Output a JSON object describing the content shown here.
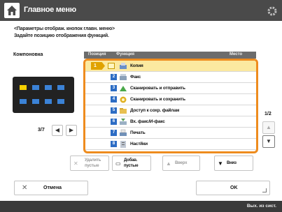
{
  "window": {
    "title": "Главное меню"
  },
  "instructions": {
    "line1": "<Параметры отображ. кнопок главн. меню>",
    "line2": "Задайте позицию отображения функций."
  },
  "layout": {
    "label": "Компоновка",
    "page_indicator": "3/7"
  },
  "list_header": {
    "col1": "Позиция",
    "col2": "Функция",
    "col3": "Место"
  },
  "list": {
    "page_indicator": "1/2",
    "rows": [
      {
        "num": "1",
        "label": "Копия",
        "selected": true,
        "icon": "copy-icon"
      },
      {
        "num": "2",
        "label": "Факс",
        "selected": false,
        "icon": "fax-icon"
      },
      {
        "num": "3",
        "label": "Сканировать и отправить",
        "selected": false,
        "icon": "scan-send-icon"
      },
      {
        "num": "4",
        "label": "Сканировать и сохранить",
        "selected": false,
        "icon": "scan-store-icon"
      },
      {
        "num": "5",
        "label": "Доступ к сохр. файлам",
        "selected": false,
        "icon": "stored-files-icon"
      },
      {
        "num": "6",
        "label": "Вх. факс/И-факс",
        "selected": false,
        "icon": "inbox-fax-icon"
      },
      {
        "num": "7",
        "label": "Печать",
        "selected": false,
        "icon": "print-icon"
      },
      {
        "num": "8",
        "label": "Настйки",
        "selected": false,
        "icon": "settings-icon"
      }
    ]
  },
  "actions": {
    "delete_blank": {
      "line1": "Удалить",
      "line2": "пустые"
    },
    "add_blank": {
      "line1": "Добав.",
      "line2": "пустые"
    },
    "up": "Вверх",
    "down": "Вниз"
  },
  "footer": {
    "cancel": "Отмена",
    "ok": "OK"
  },
  "status": {
    "text": "Вых. из сист."
  },
  "colors": {
    "accent": "#ee8c1e",
    "selected_row": "#fbe9a0",
    "cell": "#3b82d6",
    "cell_selected": "#f5d000"
  }
}
